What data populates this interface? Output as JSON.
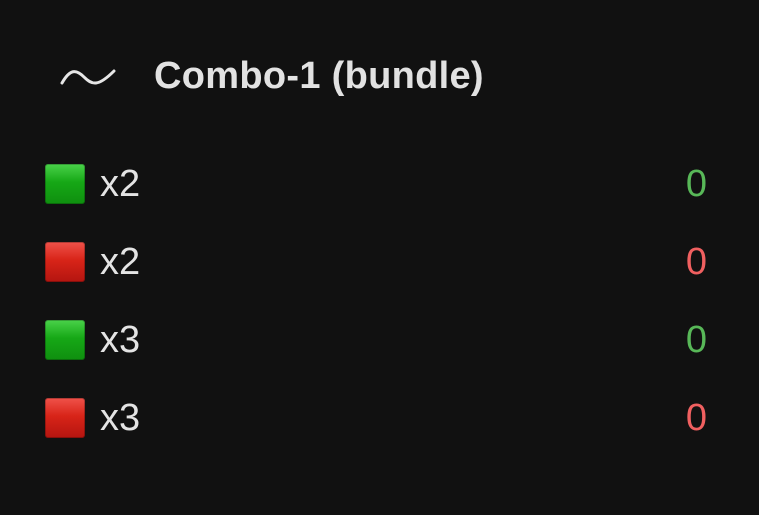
{
  "header": {
    "icon": "trend-line-icon",
    "title": "Combo-1 (bundle)"
  },
  "rows": [
    {
      "swatch": "green-square-icon",
      "swatch_color": "#16a816",
      "label": "x2",
      "value": "0",
      "value_color": "#58b858"
    },
    {
      "swatch": "red-square-icon",
      "swatch_color": "#d82418",
      "label": "x2",
      "value": "0",
      "value_color": "#f06060"
    },
    {
      "swatch": "green-square-icon",
      "swatch_color": "#16a816",
      "label": "x3",
      "value": "0",
      "value_color": "#58b858"
    },
    {
      "swatch": "red-square-icon",
      "swatch_color": "#d82418",
      "label": "x3",
      "value": "0",
      "value_color": "#f06060"
    }
  ]
}
